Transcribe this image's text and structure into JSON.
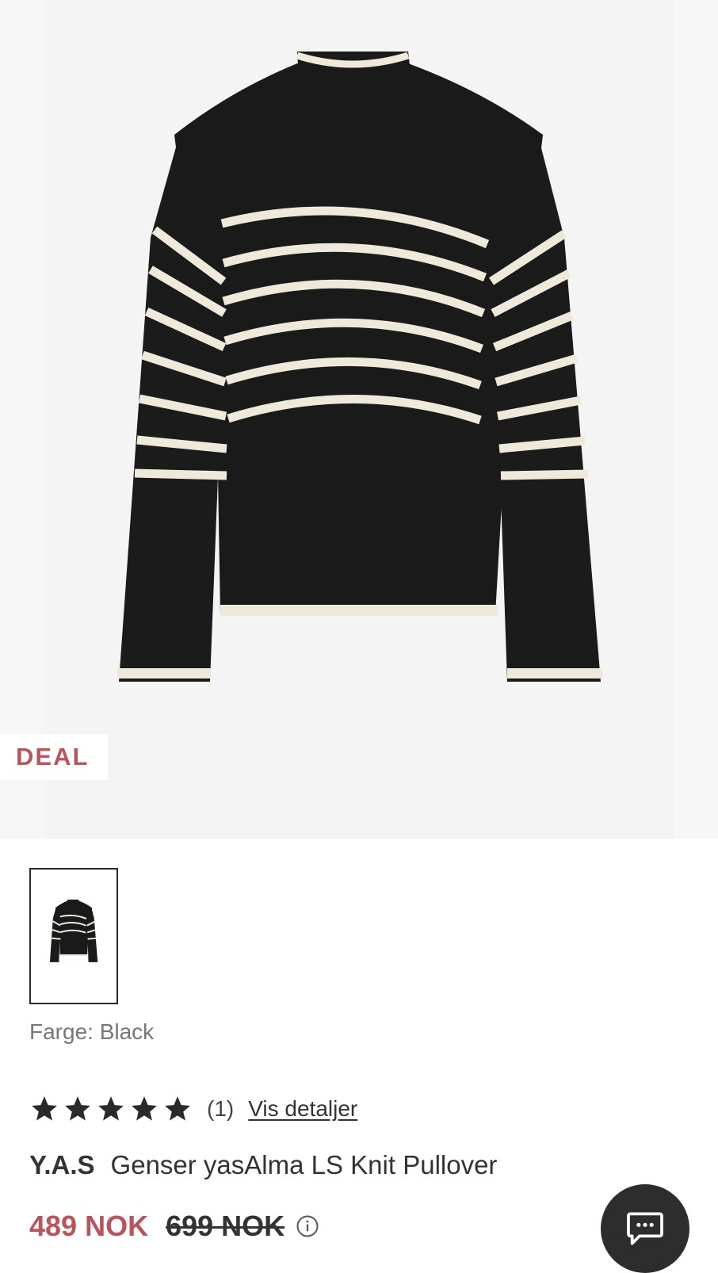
{
  "badge": {
    "label": "DEAL"
  },
  "product": {
    "color_label": "Farge: Black",
    "rating": {
      "stars": 5,
      "count": "(1)",
      "details_link": "Vis detaljer"
    },
    "brand": "Y.A.S",
    "name": "Genser yasAlma LS Knit Pullover",
    "price_current": "489 NOK",
    "price_original": "699 NOK"
  },
  "icons": {
    "info": "info-icon",
    "chat": "chat-icon",
    "star": "star-icon"
  },
  "colors": {
    "sale_red": "#b9545b",
    "text_dark": "#333333",
    "hero_bg": "#f4f4f4"
  }
}
